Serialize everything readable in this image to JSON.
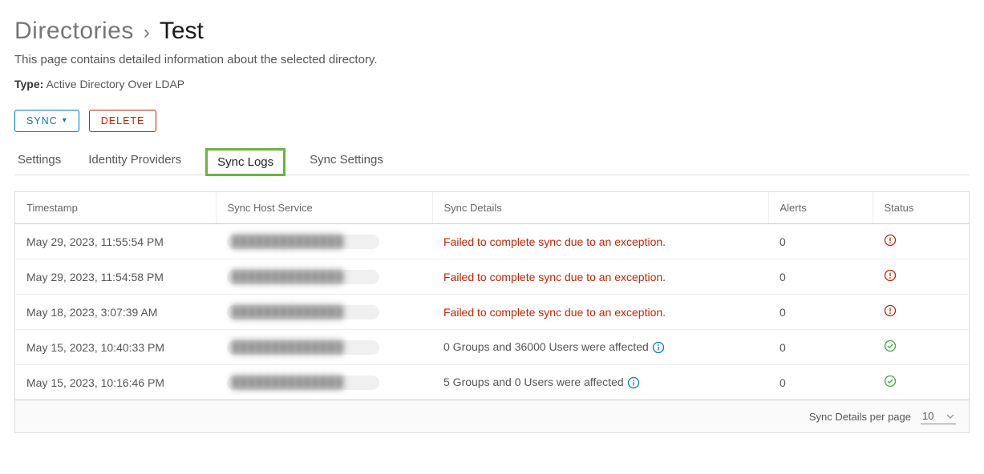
{
  "breadcrumb": {
    "parent": "Directories",
    "current": "Test"
  },
  "page_description": "This page contains detailed information about the selected directory.",
  "type_label": "Type:",
  "type_value": "Active Directory Over LDAP",
  "buttons": {
    "sync": "SYNC",
    "delete": "DELETE"
  },
  "tabs": {
    "settings": "Settings",
    "identity_providers": "Identity Providers",
    "sync_logs": "Sync Logs",
    "sync_settings": "Sync Settings"
  },
  "table": {
    "headers": {
      "timestamp": "Timestamp",
      "sync_host": "Sync Host Service",
      "sync_details": "Sync Details",
      "alerts": "Alerts",
      "status": "Status"
    },
    "rows": [
      {
        "timestamp": "May 29, 2023, 11:55:54 PM",
        "details": "Failed to complete sync due to an exception.",
        "details_kind": "error",
        "alerts": "0",
        "status": "error"
      },
      {
        "timestamp": "May 29, 2023, 11:54:58 PM",
        "details": "Failed to complete sync due to an exception.",
        "details_kind": "error",
        "alerts": "0",
        "status": "error"
      },
      {
        "timestamp": "May 18, 2023, 3:07:39 AM",
        "details": "Failed to complete sync due to an exception.",
        "details_kind": "error",
        "alerts": "0",
        "status": "error"
      },
      {
        "timestamp": "May 15, 2023, 10:40:33 PM",
        "details": "0 Groups and 36000 Users were affected",
        "details_kind": "info",
        "alerts": "0",
        "status": "ok"
      },
      {
        "timestamp": "May 15, 2023, 10:16:46 PM",
        "details": "5 Groups and 0 Users were affected",
        "details_kind": "info",
        "alerts": "0",
        "status": "ok"
      }
    ]
  },
  "footer": {
    "per_page_label": "Sync Details per page",
    "per_page_value": "10"
  },
  "icons": {
    "chevron_down": "▾"
  }
}
